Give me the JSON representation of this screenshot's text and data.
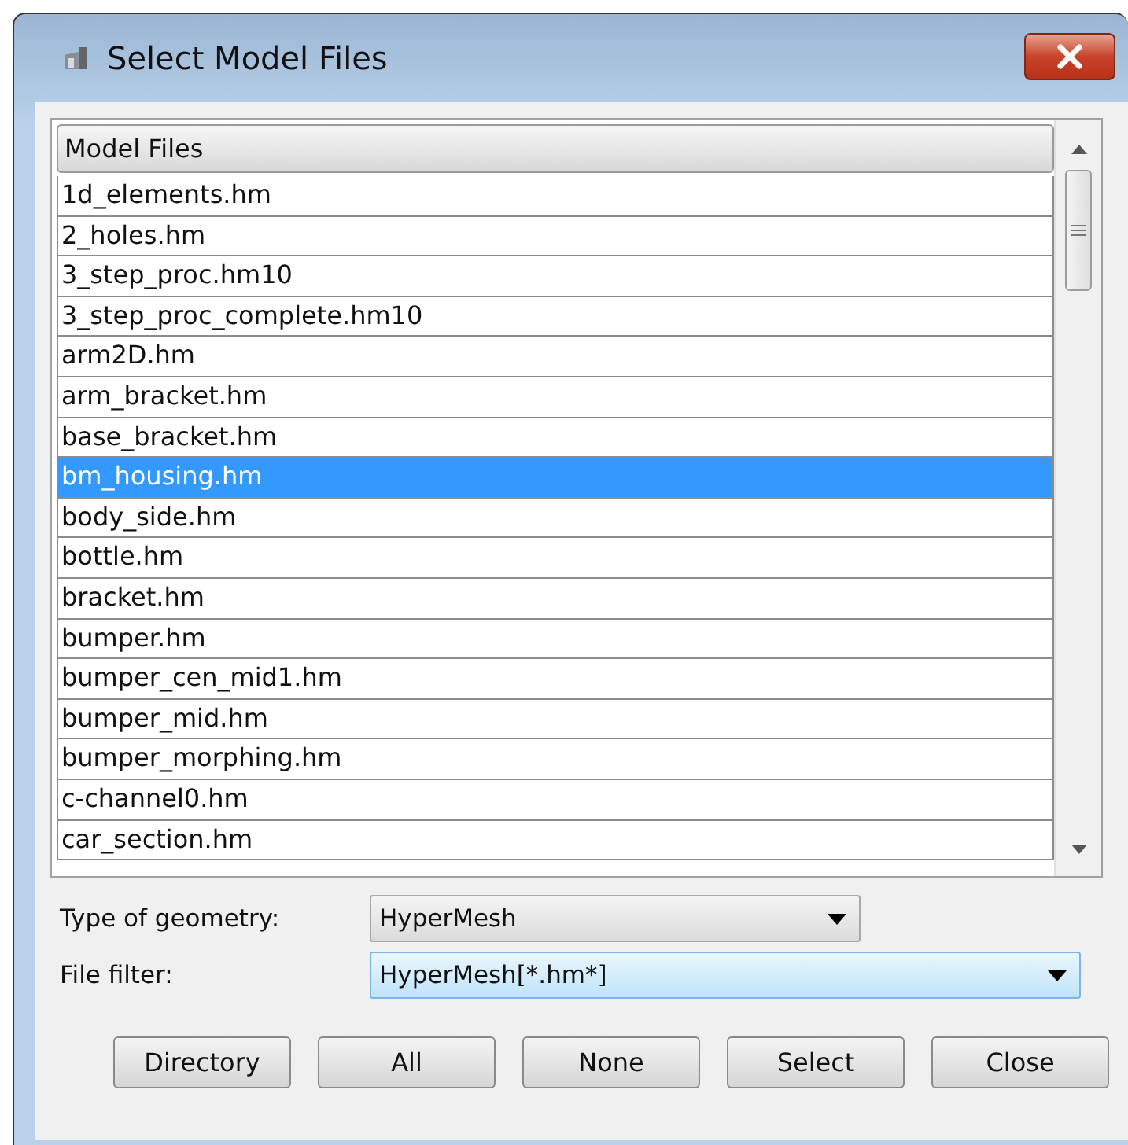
{
  "window": {
    "title": "Select Model Files"
  },
  "file_list": {
    "header": "Model Files",
    "rows": [
      {
        "name": "1d_elements.hm",
        "selected": false
      },
      {
        "name": "2_holes.hm",
        "selected": false
      },
      {
        "name": "3_step_proc.hm10",
        "selected": false
      },
      {
        "name": "3_step_proc_complete.hm10",
        "selected": false
      },
      {
        "name": "arm2D.hm",
        "selected": false
      },
      {
        "name": "arm_bracket.hm",
        "selected": false
      },
      {
        "name": "base_bracket.hm",
        "selected": false
      },
      {
        "name": "bm_housing.hm",
        "selected": true
      },
      {
        "name": "body_side.hm",
        "selected": false
      },
      {
        "name": "bottle.hm",
        "selected": false
      },
      {
        "name": "bracket.hm",
        "selected": false
      },
      {
        "name": "bumper.hm",
        "selected": false
      },
      {
        "name": "bumper_cen_mid1.hm",
        "selected": false
      },
      {
        "name": "bumper_mid.hm",
        "selected": false
      },
      {
        "name": "bumper_morphing.hm",
        "selected": false
      },
      {
        "name": "c-channel0.hm",
        "selected": false
      },
      {
        "name": "car_section.hm",
        "selected": false
      }
    ]
  },
  "geometry_type": {
    "label": "Type of geometry:",
    "value": "HyperMesh",
    "focused": false
  },
  "file_filter": {
    "label": "File filter:",
    "value": "HyperMesh[*.hm*]",
    "focused": true
  },
  "buttons": [
    "Directory",
    "All",
    "None",
    "Select",
    "Close"
  ]
}
